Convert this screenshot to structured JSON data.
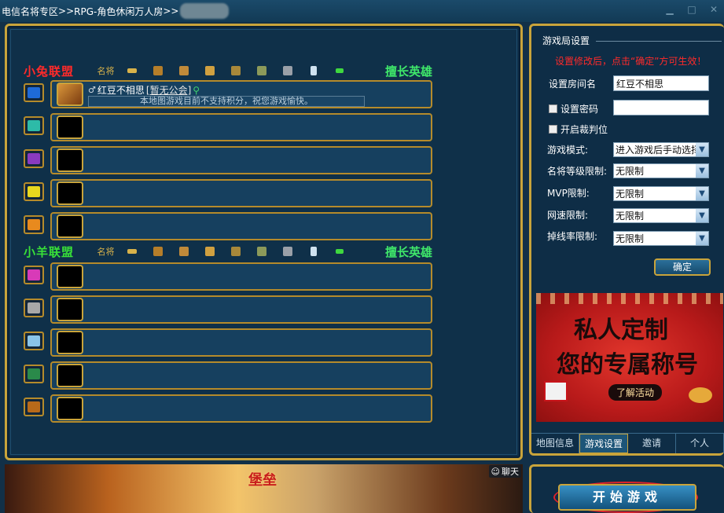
{
  "titlebar": {
    "breadcrumb": [
      "电信名将专区",
      ">>",
      "RPG-角色休闲万人房",
      ">>"
    ],
    "min_glyph": "▁",
    "max_glyph": "□",
    "close_glyph": "✕"
  },
  "teams": [
    {
      "name": "小兔联盟",
      "col_label": "名将",
      "hero_col": "擅长英雄",
      "players": [
        {
          "name": "红豆不相思",
          "guild": "[暂无公会]",
          "notice": "本地图游戏目前不支持积分，祝您游戏愉快。"
        }
      ]
    },
    {
      "name": "小羊联盟",
      "col_label": "名将",
      "hero_col": "擅长英雄"
    }
  ],
  "settings": {
    "section_title": "游戏局设置",
    "warning": "设置修改后，点击“确定”方可生效！",
    "room_name_label": "设置房间名",
    "room_name_value": "红豆不相思",
    "password_label": "设置密码",
    "password_value": "",
    "referee_label": "开启裁判位",
    "game_mode_label": "游戏模式:",
    "game_mode_value": "进入游戏后手动选择",
    "level_limit_label": "名将等级限制:",
    "level_limit_value": "无限制",
    "mvp_limit_label": "MVP限制:",
    "mvp_limit_value": "无限制",
    "ping_limit_label": "网速限制:",
    "ping_limit_value": "无限制",
    "drop_limit_label": "掉线率限制:",
    "drop_limit_value": "无限制",
    "confirm": "确定"
  },
  "ad": {
    "line1": "私人定制",
    "line2": "您的专属称号",
    "cta": "了解活动"
  },
  "tabs": [
    "地图信息",
    "游戏设置",
    "邀请",
    "个人"
  ],
  "bottom": {
    "chat": "聊天",
    "banner_logo": "堡垒"
  },
  "start_button": "开始游戏",
  "colors": {
    "frame_gold": "#c9a43b",
    "panel_bg": "#0e2d46",
    "team1": "#ff2a2a",
    "team2": "#38e038",
    "warning": "#ff2a2a"
  }
}
